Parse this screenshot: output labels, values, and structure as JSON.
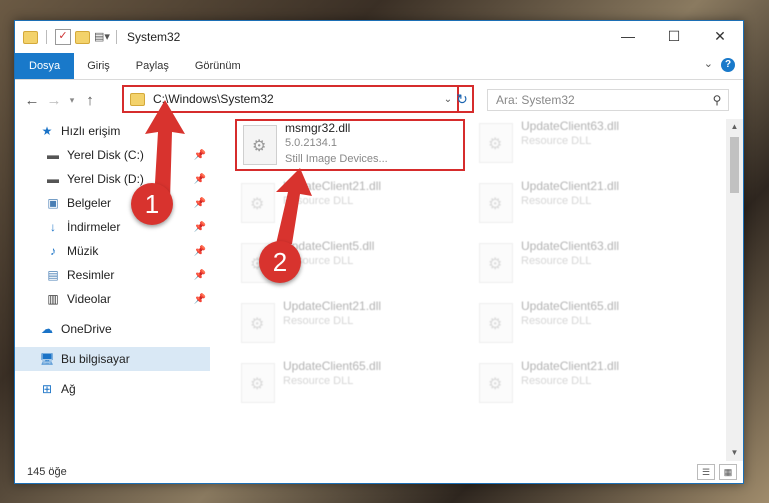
{
  "window": {
    "title": "System32"
  },
  "ribbon": {
    "tabs": [
      "Dosya",
      "Giriş",
      "Paylaş",
      "Görünüm"
    ],
    "help": "?"
  },
  "address": {
    "path": "C:\\Windows\\System32"
  },
  "search": {
    "placeholder": "Ara: System32"
  },
  "sidebar": {
    "quick_access": "Hızlı erişim",
    "items": [
      {
        "label": "Yerel Disk (C:)",
        "icon": "drive-icon"
      },
      {
        "label": "Yerel Disk (D:)",
        "icon": "drive-icon"
      },
      {
        "label": "Belgeler",
        "icon": "documents-icon"
      },
      {
        "label": "İndirmeler",
        "icon": "download-icon"
      },
      {
        "label": "Müzik",
        "icon": "music-icon"
      },
      {
        "label": "Resimler",
        "icon": "pictures-icon"
      },
      {
        "label": "Videolar",
        "icon": "videos-icon"
      }
    ],
    "onedrive": "OneDrive",
    "this_pc": "Bu bilgisayar",
    "network": "Ağ"
  },
  "files": [
    {
      "name": "msmgr32.dll",
      "line2": "5.0.2134.1",
      "line3": "Still Image Devices..."
    },
    {
      "name": "UpdateClient63.dll",
      "line2": "Resource DLL"
    },
    {
      "name": "UpdateClient21.dll",
      "line2": "Resource DLL"
    },
    {
      "name": "UpdateClient21.dll",
      "line2": "Resource DLL"
    },
    {
      "name": "UpdateClient5.dll",
      "line2": "Resource DLL"
    },
    {
      "name": "UpdateClient63.dll",
      "line2": "Resource DLL"
    },
    {
      "name": "UpdateClient21.dll",
      "line2": "Resource DLL"
    },
    {
      "name": "UpdateClient65.dll",
      "line2": "Resource DLL"
    },
    {
      "name": "UpdateClient65.dll",
      "line2": "Resource DLL"
    },
    {
      "name": "UpdateClient21.dll",
      "line2": "Resource DLL"
    }
  ],
  "status": {
    "count": "145 öğe"
  },
  "callouts": [
    "1",
    "2"
  ],
  "colors": {
    "accent": "#1979ca",
    "highlight": "#d62c2c"
  }
}
